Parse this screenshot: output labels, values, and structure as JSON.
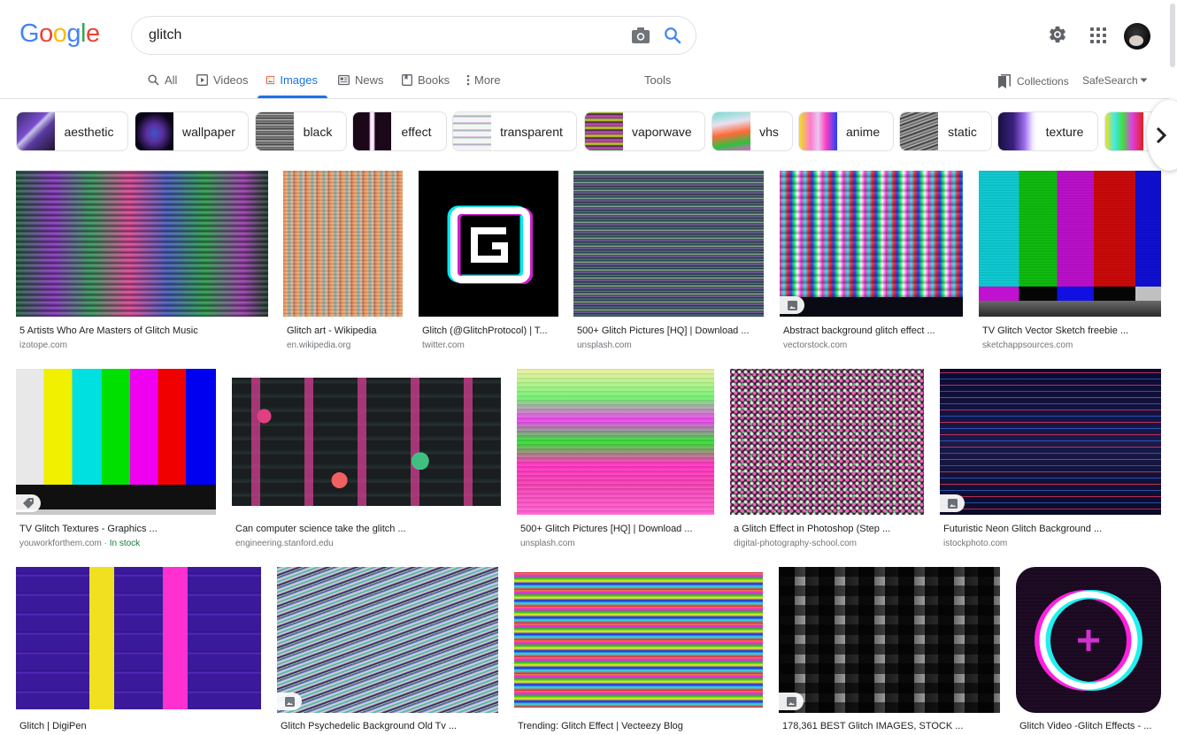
{
  "logo": {
    "text": "Google",
    "letters": [
      {
        "ch": "G",
        "color": "#4285F4"
      },
      {
        "ch": "o",
        "color": "#EA4335"
      },
      {
        "ch": "o",
        "color": "#FBBC05"
      },
      {
        "ch": "g",
        "color": "#4285F4"
      },
      {
        "ch": "l",
        "color": "#34A853"
      },
      {
        "ch": "e",
        "color": "#EA4335"
      }
    ]
  },
  "search": {
    "value": "glitch",
    "camera_icon": "camera-icon",
    "search_icon": "search-icon"
  },
  "header_right": {
    "settings_icon": "gear-icon",
    "apps_icon": "apps-grid-icon",
    "account": "avatar"
  },
  "tabs": [
    {
      "label": "All",
      "icon": "search-icon",
      "active": false
    },
    {
      "label": "Videos",
      "icon": "play-icon",
      "active": false
    },
    {
      "label": "Images",
      "icon": "image-icon",
      "active": true
    },
    {
      "label": "News",
      "icon": "news-icon",
      "active": false
    },
    {
      "label": "Books",
      "icon": "book-icon",
      "active": false
    },
    {
      "label": "More",
      "icon": "more-vert-icon",
      "active": false
    }
  ],
  "tools_label": "Tools",
  "collections_label": "Collections",
  "safesearch_label": "SafeSearch",
  "chips": [
    {
      "label": "aesthetic"
    },
    {
      "label": "wallpaper"
    },
    {
      "label": "black"
    },
    {
      "label": "effect"
    },
    {
      "label": "transparent"
    },
    {
      "label": "vaporwave"
    },
    {
      "label": "vhs"
    },
    {
      "label": "anime"
    },
    {
      "label": "static"
    },
    {
      "label": "texture"
    }
  ],
  "accent_color": "#1a73e8",
  "results": [
    {
      "title": "5 Artists Who Are Masters of Glitch Music",
      "source": "izotope.com"
    },
    {
      "title": "Glitch art - Wikipedia",
      "source": "en.wikipedia.org"
    },
    {
      "title": "Glitch (@GlitchProtocol) | T...",
      "source": "twitter.com"
    },
    {
      "title": "500+ Glitch Pictures [HQ] | Download ...",
      "source": "unsplash.com"
    },
    {
      "title": "Abstract background glitch effect ...",
      "source": "vectorstock.com",
      "badge": "image-icon"
    },
    {
      "title": "TV Glitch Vector Sketch freebie ...",
      "source": "sketchappsources.com"
    },
    {
      "title": "TV Glitch Textures - Graphics ...",
      "source": "youworkforthem.com",
      "extra": "In stock",
      "badge": "tag-icon"
    },
    {
      "title": "Can computer science take the glitch ...",
      "source": "engineering.stanford.edu"
    },
    {
      "title": "500+ Glitch Pictures [HQ] | Download ...",
      "source": "unsplash.com"
    },
    {
      "title": "a Glitch Effect in Photoshop (Step ...",
      "source": "digital-photography-school.com"
    },
    {
      "title": "Futuristic Neon Glitch Background ...",
      "source": "istockphoto.com",
      "badge": "image-icon"
    },
    {
      "title": "Glitch | DigiPen",
      "source": ""
    },
    {
      "title": "Glitch Psychedelic Background Old Tv ...",
      "source": "",
      "badge": "image-icon"
    },
    {
      "title": "Trending: Glitch Effect | Vecteezy Blog",
      "source": ""
    },
    {
      "title": "178,361 BEST Glitch IMAGES, STOCK ...",
      "source": "",
      "badge": "image-icon"
    },
    {
      "title": "Glitch Video -Glitch Effects - ...",
      "source": ""
    }
  ]
}
